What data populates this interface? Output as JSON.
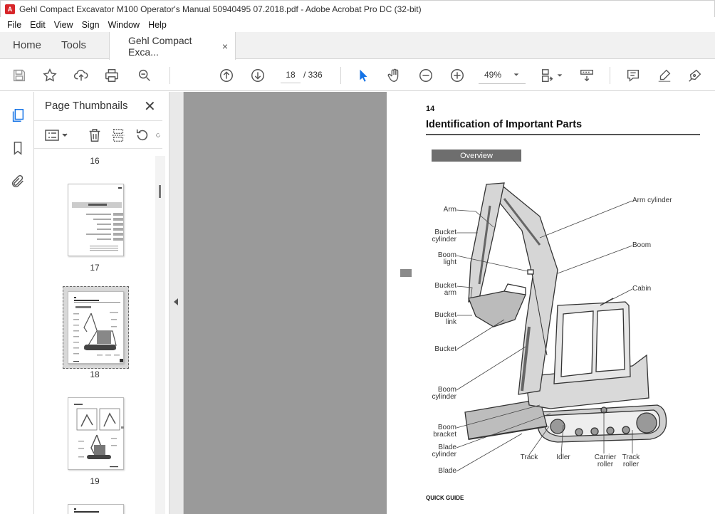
{
  "window": {
    "title": "Gehl Compact Excavator M100 Operator's Manual 50940495 07.2018.pdf - Adobe Acrobat Pro DC (32-bit)"
  },
  "menu": [
    "File",
    "Edit",
    "View",
    "Sign",
    "Window",
    "Help"
  ],
  "tabs": {
    "home": "Home",
    "tools": "Tools",
    "doc": "Gehl Compact Exca...",
    "close": "×"
  },
  "toolbar": {
    "page_current": "18",
    "page_total": "/ 336",
    "zoom": "49%",
    "icons": [
      "save-icon",
      "bookmark-star-icon",
      "upload-icon",
      "print-icon",
      "zoom-search-icon",
      "prev-page-icon",
      "next-page-icon",
      "select-cursor-icon",
      "hand-icon",
      "zoom-out-icon",
      "zoom-in-icon",
      "fit-page-icon",
      "scroll-mode-icon",
      "comment-icon",
      "highlight-icon",
      "sign-icon"
    ]
  },
  "thumbnails": {
    "title": "Page Thumbnails",
    "close": "✕",
    "pages": [
      {
        "label": "16"
      },
      {
        "label": "17"
      },
      {
        "label": "18",
        "selected": true
      },
      {
        "label": "19"
      }
    ]
  },
  "page": {
    "number": "14",
    "heading": "Identification of Important Parts",
    "badge": "Overview",
    "footer": "QUICK GUIDE",
    "labels": {
      "arm": "Arm",
      "bucket_cylinder": [
        "Bucket",
        "cylinder"
      ],
      "boom_light": [
        "Boom",
        "light"
      ],
      "bucket_arm": [
        "Bucket",
        "arm"
      ],
      "bucket_link": [
        "Bucket",
        "link"
      ],
      "bucket": "Bucket",
      "boom_cylinder": [
        "Boom",
        "cylinder"
      ],
      "boom_bracket": [
        "Boom",
        "bracket"
      ],
      "blade_cylinder": [
        "Blade",
        "cylinder"
      ],
      "blade": "Blade",
      "arm_cylinder": "Arm cylinder",
      "boom": "Boom",
      "cabin": "Cabin",
      "track": "Track",
      "idler": "Idler",
      "carrier_roller": [
        "Carrier",
        "roller"
      ],
      "track_roller": [
        "Track",
        "roller"
      ]
    }
  },
  "colors": {
    "accent_red": "#d7262a",
    "select_blue": "#1473e6",
    "doc_bg": "#9a9a9a"
  }
}
